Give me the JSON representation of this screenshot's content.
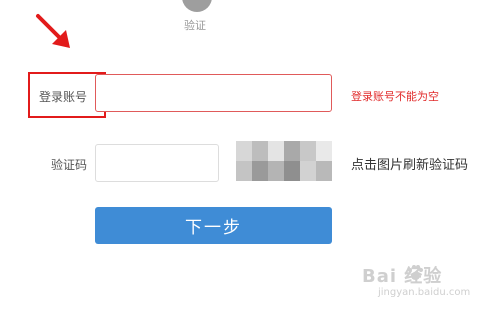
{
  "step": {
    "label": "验证"
  },
  "form": {
    "account_label": "登录账号",
    "account_value": "",
    "account_error": "登录账号不能为空",
    "captcha_label": "验证码",
    "captcha_value": "",
    "captcha_hint": "点击图片刷新验证码",
    "next_label": "下一步"
  },
  "watermark": {
    "brand": "Bai  经验",
    "url": "jingyan.baidu.com"
  },
  "colors": {
    "accent": "#3f8cd6",
    "error": "#e12b2b",
    "annotation": "#e21b1b"
  },
  "icons": {
    "annotation_arrow": "arrow-down-right-icon",
    "watermark_paw": "paw-icon"
  }
}
